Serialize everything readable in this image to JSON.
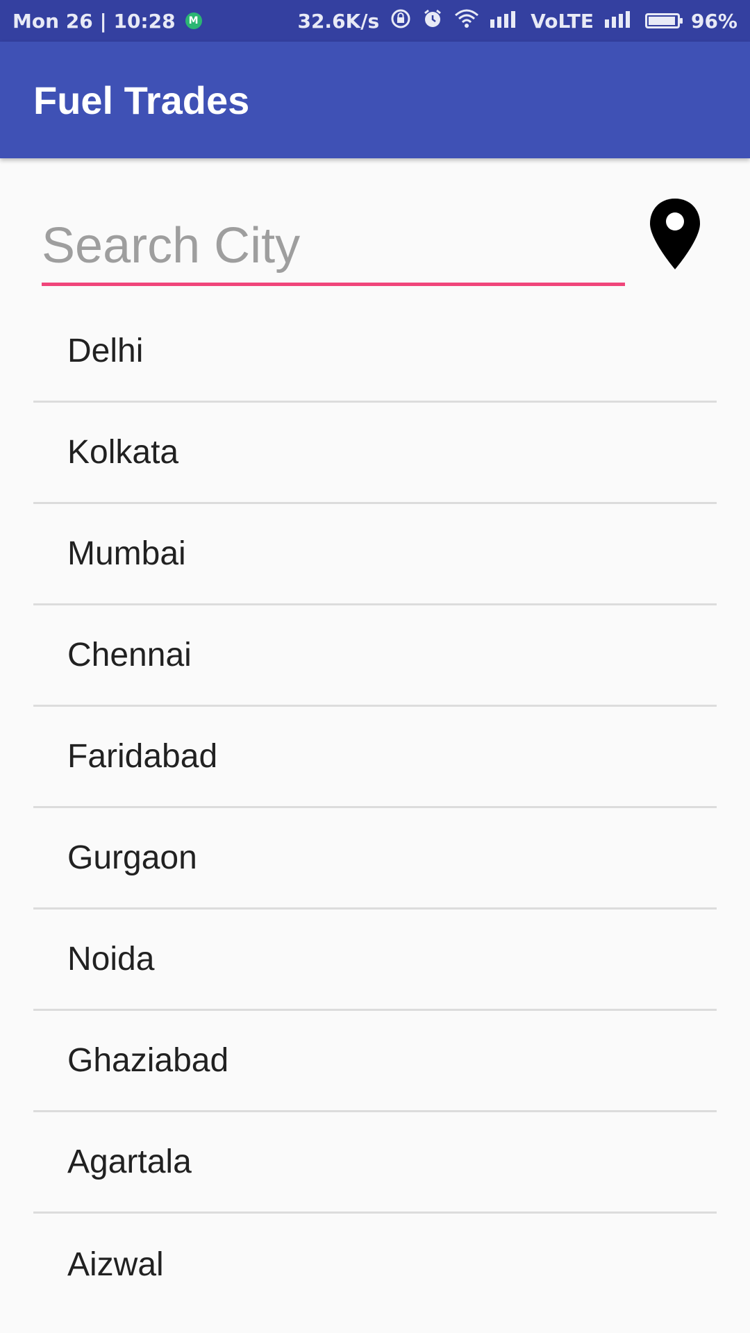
{
  "status_bar": {
    "datetime": "Mon 26 | 10:28",
    "app_indicator": "M",
    "net_speed": "32.6K/s",
    "network": "VoLTE",
    "battery_percent": "96%",
    "battery_level": 0.96
  },
  "app_bar": {
    "title": "Fuel Trades"
  },
  "search": {
    "placeholder": "Search City",
    "value": ""
  },
  "location_button": {
    "icon": "map-marker-icon"
  },
  "colors": {
    "primary": "#3f51b5",
    "primary_dark": "#3440a0",
    "accent": "#f0457a"
  },
  "cities": [
    "Delhi",
    "Kolkata",
    "Mumbai",
    "Chennai",
    "Faridabad",
    "Gurgaon",
    "Noida",
    "Ghaziabad",
    "Agartala",
    "Aizwal"
  ]
}
